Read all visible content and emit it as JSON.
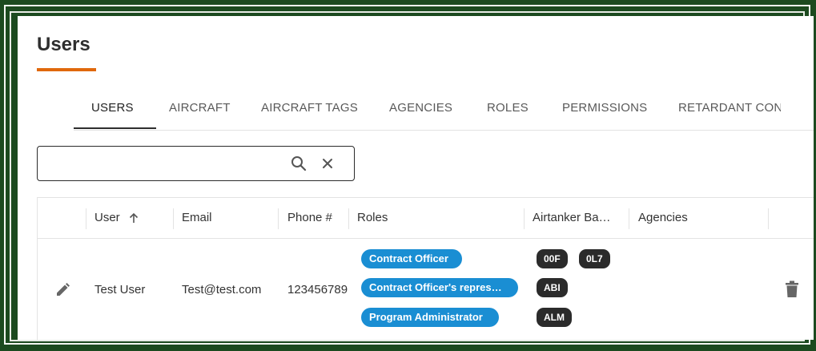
{
  "page": {
    "title": "Users"
  },
  "tabs": [
    {
      "label": "USERS",
      "active": true
    },
    {
      "label": "AIRCRAFT"
    },
    {
      "label": "AIRCRAFT TAGS"
    },
    {
      "label": "AGENCIES"
    },
    {
      "label": "ROLES"
    },
    {
      "label": "PERMISSIONS"
    },
    {
      "label": "RETARDANT CON"
    }
  ],
  "search": {
    "value": "",
    "placeholder": ""
  },
  "table": {
    "columns": [
      "User",
      "Email",
      "Phone #",
      "Roles",
      "Airtanker Ba…",
      "Agencies"
    ],
    "sort": {
      "column": "User",
      "direction": "ascending"
    },
    "rows": [
      {
        "user": "Test User",
        "email": "Test@test.com",
        "phone": "123456789",
        "roles": [
          "Contract Officer",
          "Contract Officer's repres…",
          "Program Administrator"
        ],
        "bases": [
          "00F",
          "0L7",
          "ABI",
          "ALM"
        ],
        "agencies": ""
      }
    ]
  },
  "colors": {
    "accent": "#e0680c",
    "role_chip": "#1a8ed3",
    "base_chip": "#2b2b2b",
    "background": "#1c4a1f"
  }
}
